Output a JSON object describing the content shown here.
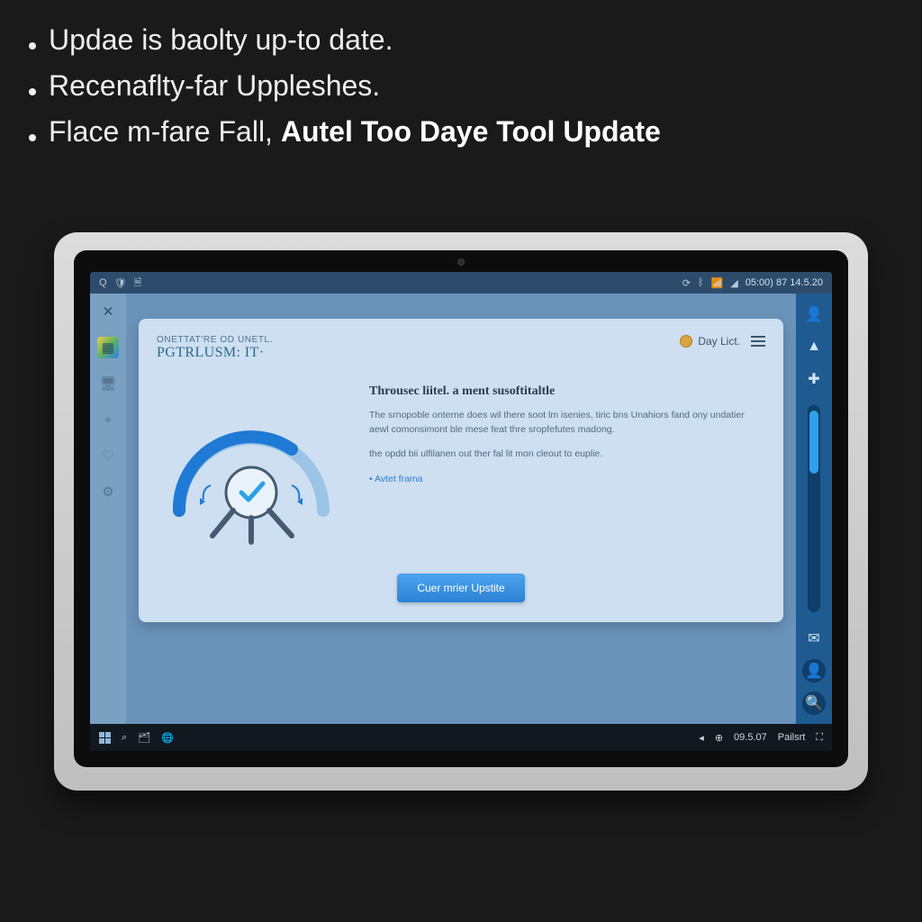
{
  "overlay": {
    "bullet1": "Updae is baolty up-to date.",
    "bullet2": "Recenaflty-far Uppleshes.",
    "bullet3_prefix": "Flace m-fare Fall, ",
    "bullet3_strong": "Autel Too Daye Tool Update"
  },
  "statusbar": {
    "search_icon": "Q",
    "time_text": "05:00) 87 14.5.20"
  },
  "rail_left": {
    "items": [
      {
        "name": "close-icon",
        "glyph": "✕"
      },
      {
        "name": "apps-icon",
        "glyph": "▦"
      },
      {
        "name": "device-icon",
        "glyph": "🖥"
      },
      {
        "name": "scan-icon",
        "glyph": "⌖"
      },
      {
        "name": "heart-icon",
        "glyph": "♡"
      },
      {
        "name": "settings-icon",
        "glyph": "⚙"
      }
    ]
  },
  "card": {
    "eyebrow": "Onettat're od Unetl.",
    "brand_title": "PGTRLUSM: IT·",
    "daylict_label": "Day Lict.",
    "heading": "Throusec liitel. a ment susoftitaltle",
    "body_line1": "The srnopoble onterne does wil there soot lm isenies, tiric bns Unahiors fand ony undatier aewl comonsimont ble mese feat thre sropfefutes madong.",
    "body_line2": "the opdd bii ulfilanen out ther fal lit mon cleout to euplie.",
    "link_text": "Avtet frama",
    "cta_label": "Cuer mrier Upstite"
  },
  "rail_right": {
    "items_top": [
      {
        "name": "user-icon",
        "glyph": "👤"
      },
      {
        "name": "up-arrow-icon",
        "glyph": "▲"
      },
      {
        "name": "add-icon",
        "glyph": "✚"
      }
    ],
    "items_bottom": [
      {
        "name": "mail-icon",
        "glyph": "✉"
      },
      {
        "name": "profile-icon",
        "glyph": "👤"
      },
      {
        "name": "search-icon",
        "glyph": "🔍"
      }
    ]
  },
  "taskbar": {
    "clock": "09.5.07",
    "clock_label": "Pailsrt"
  },
  "colors": {
    "accent": "#2f80ed",
    "card_bg": "#cddff0",
    "rail_right_bg": "#1f5b91"
  }
}
